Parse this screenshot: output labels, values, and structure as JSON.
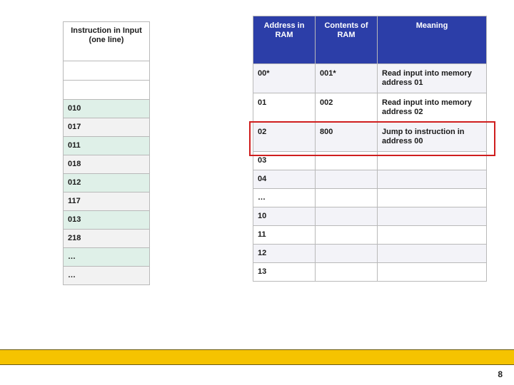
{
  "left": {
    "header": "Instruction in Input (one line)",
    "rows": [
      {
        "style": "empty",
        "v": ""
      },
      {
        "style": "empty",
        "v": ""
      },
      {
        "style": "green",
        "v": "010"
      },
      {
        "style": "gray",
        "v": "017"
      },
      {
        "style": "green",
        "v": "011"
      },
      {
        "style": "gray",
        "v": "018"
      },
      {
        "style": "green",
        "v": "012"
      },
      {
        "style": "gray",
        "v": "117"
      },
      {
        "style": "green",
        "v": "013"
      },
      {
        "style": "gray",
        "v": "218"
      },
      {
        "style": "green",
        "v": "…"
      },
      {
        "style": "gray",
        "v": "…"
      }
    ]
  },
  "ram": {
    "headers": {
      "addr": "Address in RAM",
      "cont": "Contents of RAM",
      "mean": "Meaning"
    },
    "rows": [
      {
        "alt": true,
        "addr": "00*",
        "cont": "001*",
        "mean": "Read input into memory address 01"
      },
      {
        "alt": false,
        "addr": "01",
        "cont": "002",
        "mean": "Read input into memory address 02"
      },
      {
        "alt": true,
        "addr": "02",
        "cont": "800",
        "mean": "Jump to instruction in address 00",
        "highlight": true
      },
      {
        "alt": false,
        "addr": "03",
        "cont": "",
        "mean": ""
      },
      {
        "alt": true,
        "addr": "04",
        "cont": "",
        "mean": ""
      },
      {
        "alt": false,
        "addr": "…",
        "cont": "",
        "mean": ""
      },
      {
        "alt": true,
        "addr": "10",
        "cont": "",
        "mean": ""
      },
      {
        "alt": false,
        "addr": "11",
        "cont": "",
        "mean": ""
      },
      {
        "alt": true,
        "addr": "12",
        "cont": "",
        "mean": ""
      },
      {
        "alt": false,
        "addr": "13",
        "cont": "",
        "mean": ""
      }
    ]
  },
  "page_number": "8"
}
